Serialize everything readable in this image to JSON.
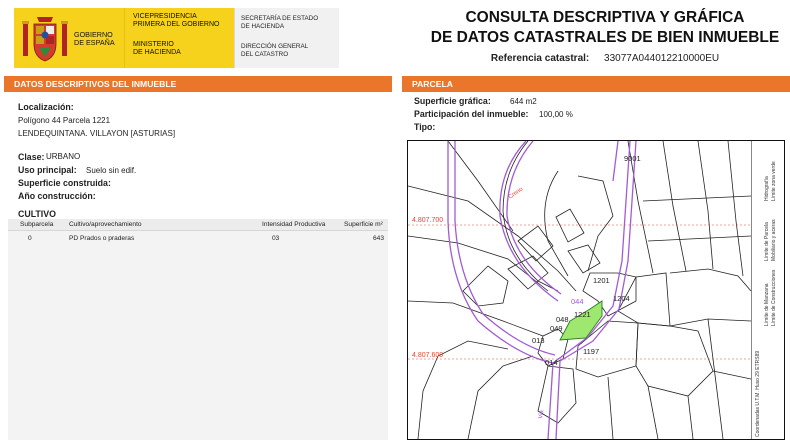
{
  "header": {
    "gov_name": [
      "GOBIERNO",
      "DE ESPAÑA"
    ],
    "vicepresidencia": [
      "VICEPRESIDENCIA",
      "PRIMERA DEL GOBIERNO"
    ],
    "ministerio": [
      "MINISTERIO",
      "DE HACIENDA"
    ],
    "secretaria": [
      "SECRETARÍA DE ESTADO",
      "DE HACIENDA"
    ],
    "direccion": [
      "DIRECCIÓN GENERAL",
      "DEL CATASTRO"
    ],
    "title_line1": "CONSULTA DESCRIPTIVA Y GRÁFICA",
    "title_line2": "DE DATOS CATASTRALES DE BIEN INMUEBLE",
    "ref_label": "Referencia catastral:",
    "ref_value": "33077A044012210000EU"
  },
  "left": {
    "section_title": "DATOS DESCRIPTIVOS DEL INMUEBLE",
    "localizacion_label": "Localización:",
    "localizacion_line1": "Polígono 44 Parcela 1221",
    "localizacion_line2": "LENDEQUINTANA. VILLAYON [ASTURIAS]",
    "clase_label": "Clase:",
    "clase_value": "URBANO",
    "uso_label": "Uso principal:",
    "uso_value": "Suelo sin edif.",
    "superficie_label": "Superficie construida:",
    "anio_label": "Año construcción:",
    "cultivo_title": "CULTIVO",
    "cultivo_headers": [
      "Subparcela",
      "Cultivo/aprovechamiento",
      "Intensidad Productiva",
      "Superficie m²"
    ],
    "cultivo_rows": [
      [
        "0",
        "PD Prados o praderas",
        "03",
        "643"
      ]
    ]
  },
  "right": {
    "section_title": "PARCELA",
    "superficie_label": "Superficie gráfica:",
    "superficie_value": "644 m2",
    "participacion_label": "Participación del inmueble:",
    "participacion_value": "100,00 %",
    "tipo_label": "Tipo:",
    "map": {
      "coord_top": "4.807.700",
      "coord_bottom": "4.807.600",
      "parcels": [
        "9001",
        "1201",
        "1204",
        "1221",
        "1197",
        "014",
        "013",
        "049",
        "048",
        "044"
      ],
      "road_labels": [
        "Cmno",
        "Via"
      ],
      "legend": [
        "Límite de Manzana",
        "Límite de Parcela",
        "Límite de Construcciones",
        "Mobiliario y aceras",
        "Límite zona verde",
        "Hidrografía",
        "Coordenadas U.T.M. Huso 29 ETRS89"
      ],
      "colors": {
        "selected_parcel": "#9ee86f",
        "road": "#a25bd3",
        "coord": "#e64532"
      }
    }
  }
}
